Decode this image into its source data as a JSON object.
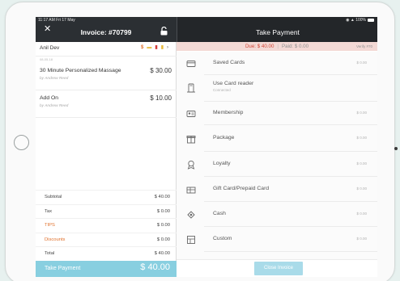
{
  "status": {
    "time": "11:17 AM   Fri 17 May",
    "right": "◉ ▲ 100%"
  },
  "invoice": {
    "close": "✕",
    "title": "Invoice: #70799"
  },
  "client": {
    "name": "Anil Dev",
    "sub": "08-05-18",
    "icons": [
      {
        "glyph": "$",
        "color": "#e0702b"
      },
      {
        "glyph": "▬",
        "color": "#e8b93a"
      },
      {
        "glyph": "▮",
        "color": "#d23b3b"
      },
      {
        "glyph": "▮",
        "color": "#e8b93a"
      },
      {
        "glyph": "›",
        "color": "#777777"
      }
    ]
  },
  "items": [
    {
      "name": "30 Minute Personalized Massage",
      "price": "$ 30.00",
      "staff": "by Andrew Reed"
    },
    {
      "name": "Add On",
      "price": "$ 10.00",
      "staff": "by Andrew Reed"
    }
  ],
  "totals": [
    {
      "label": "Subtotal",
      "value": "$ 40.00",
      "highlight": false
    },
    {
      "label": "Tax",
      "value": "$ 0.00",
      "highlight": false
    },
    {
      "label": "TIPS",
      "value": "$ 0.00",
      "highlight": true
    },
    {
      "label": "Discounts",
      "value": "$ 0.00",
      "highlight": true
    },
    {
      "label": "Total",
      "value": "$ 40.00",
      "highlight": false
    }
  ],
  "take_payment": {
    "label": "Take Payment",
    "amount": "$ 40.00"
  },
  "right": {
    "title": "Take Payment",
    "due": "Due: $ 40.00",
    "paid": "Paid: $ 0.00",
    "verify": "Verify #70"
  },
  "methods": [
    {
      "label": "Saved Cards",
      "sub": "",
      "amount": "$ 0.00",
      "icon": "card-icon"
    },
    {
      "label": "Use Card reader",
      "sub": "Connected",
      "amount": "",
      "icon": "card-reader-icon"
    },
    {
      "label": "Membership",
      "sub": "",
      "amount": "$ 0.00",
      "icon": "membership-icon"
    },
    {
      "label": "Package",
      "sub": "",
      "amount": "$ 0.00",
      "icon": "package-icon"
    },
    {
      "label": "Loyalty",
      "sub": "",
      "amount": "$ 0.00",
      "icon": "loyalty-icon"
    },
    {
      "label": "Gift Card/Prepaid Card",
      "sub": "",
      "amount": "$ 0.00",
      "icon": "gift-card-icon"
    },
    {
      "label": "Cash",
      "sub": "",
      "amount": "$ 0.00",
      "icon": "cash-icon"
    },
    {
      "label": "Custom",
      "sub": "",
      "amount": "$ 0.00",
      "icon": "custom-icon"
    }
  ],
  "footer": {
    "close_label": "Close Invoice"
  },
  "colors": {
    "accent": "#88cfe0",
    "due": "#d24636",
    "due_bg": "#f3d9d5",
    "header": "#2b2f33",
    "orange": "#e0702b"
  }
}
